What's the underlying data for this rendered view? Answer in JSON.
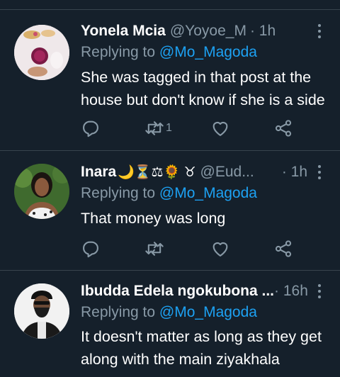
{
  "tweets": [
    {
      "name": "Yonela Mcia",
      "handle": "@Yoyoe_M",
      "time": "· 1h",
      "replying_prefix": "Replying to",
      "mention": "@Mo_Magoda",
      "text": "She was tagged in that post at the house but don't know if she is a side",
      "retweet_count": "1",
      "avatar": "food-photo-avatar"
    },
    {
      "name": "Inara",
      "emojis": "🌙⏳⚖🌻 ♉",
      "handle": "@Eud...",
      "time": "· 1h",
      "replying_prefix": "Replying to",
      "mention": "@Mo_Magoda",
      "text": "That money was long",
      "retweet_count": "",
      "avatar": "woman-portrait-avatar"
    },
    {
      "name": "Ibudda Edela ngokubona ...",
      "handle": "",
      "time": "· 16h",
      "replying_prefix": "Replying to",
      "mention": "@Mo_Magoda",
      "text": "It doesn't matter as long as they get along with the main ziyakhala",
      "retweet_count": "",
      "avatar": "man-portrait-avatar"
    }
  ],
  "colors": {
    "background": "#15202b",
    "secondary_text": "#8899a6",
    "accent": "#1da1f2",
    "divider": "#38444d"
  }
}
